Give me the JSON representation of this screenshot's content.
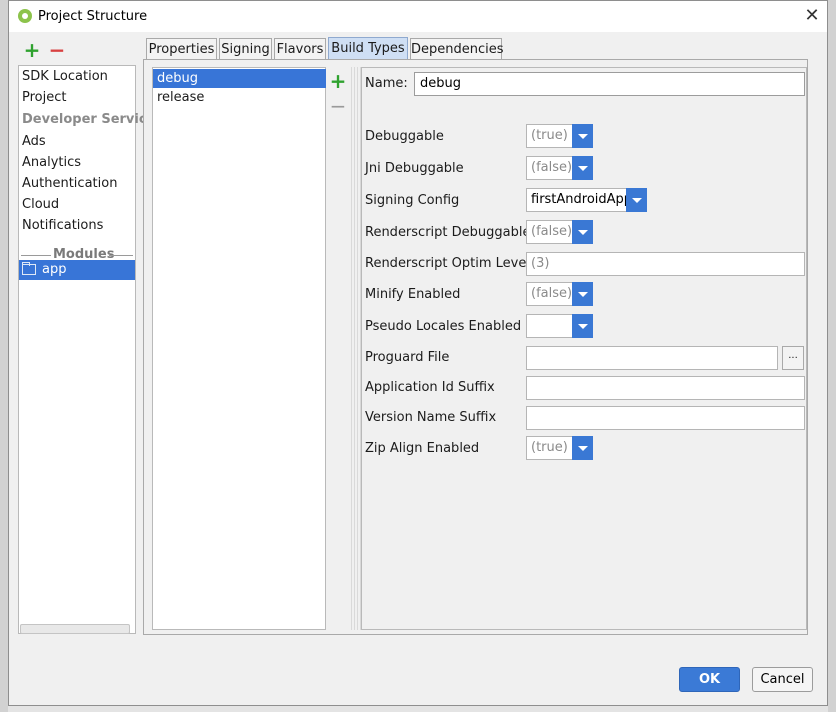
{
  "window": {
    "title": "Project Structure",
    "close_glyph": "✕"
  },
  "left_panel": {
    "add_glyph": "+",
    "remove_glyph": "−",
    "items": [
      {
        "label": "SDK Location"
      },
      {
        "label": "Project"
      }
    ],
    "group_label": "Developer Services",
    "services": [
      {
        "label": "Ads"
      },
      {
        "label": "Analytics"
      },
      {
        "label": "Authentication"
      },
      {
        "label": "Cloud"
      },
      {
        "label": "Notifications"
      }
    ],
    "modules_label": "Modules",
    "module_selected": "app"
  },
  "tabs": [
    {
      "label": "Properties"
    },
    {
      "label": "Signing"
    },
    {
      "label": "Flavors"
    },
    {
      "label": "Build Types",
      "active": true
    },
    {
      "label": "Dependencies"
    }
  ],
  "build_types": {
    "items": [
      "debug",
      "release"
    ],
    "selected": "debug",
    "add_glyph": "+",
    "remove_glyph": "−"
  },
  "form": {
    "name_label": "Name:",
    "name_value": "debug",
    "fields": {
      "debuggable": {
        "label": "Debuggable",
        "value": "(true)"
      },
      "jni_debuggable": {
        "label": "Jni Debuggable",
        "value": "(false)"
      },
      "signing_config": {
        "label": "Signing Config",
        "value": "firstAndroidApp"
      },
      "renderscript_debuggable": {
        "label": "Renderscript Debuggable",
        "value": "(false)"
      },
      "renderscript_optim_level": {
        "label": "Renderscript Optim Level",
        "value": "(3)"
      },
      "minify_enabled": {
        "label": "Minify Enabled",
        "value": "(false)"
      },
      "pseudo_locales_enabled": {
        "label": "Pseudo Locales Enabled",
        "value": ""
      },
      "proguard_file": {
        "label": "Proguard File",
        "value": ""
      },
      "application_id_suffix": {
        "label": "Application Id Suffix",
        "value": ""
      },
      "version_name_suffix": {
        "label": "Version Name Suffix",
        "value": ""
      },
      "zip_align_enabled": {
        "label": "Zip Align Enabled",
        "value": "(true)"
      }
    },
    "browse_glyph": "..."
  },
  "footer": {
    "ok_label": "OK",
    "cancel_label": "Cancel"
  },
  "colors": {
    "accent": "#3875d7",
    "add": "#2fa22f",
    "remove": "#d84040"
  }
}
